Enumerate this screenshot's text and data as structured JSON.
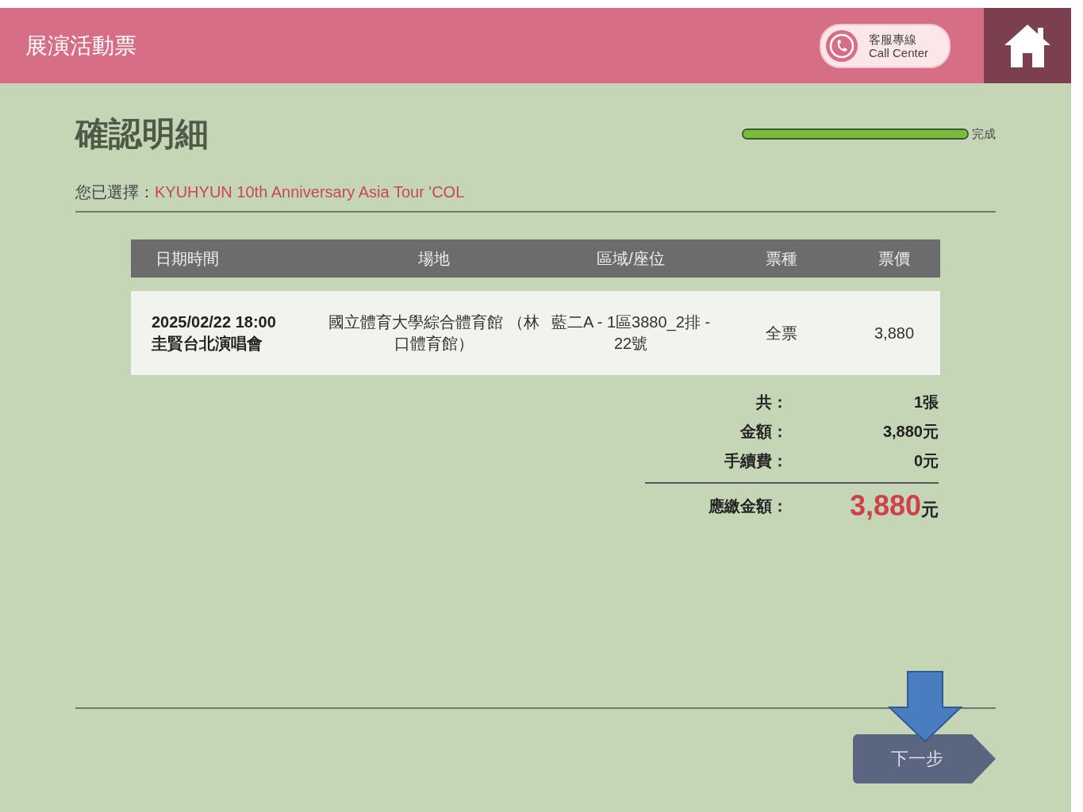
{
  "header": {
    "title": "展演活動票",
    "call_center": {
      "line1": "客服專線",
      "line2": "Call Center"
    }
  },
  "page_title": "確認明細",
  "progress": {
    "level": 1,
    "label": "完成"
  },
  "selection": {
    "label": "您已選擇：",
    "event": "KYUHYUN 10th Anniversary Asia Tour 'COL"
  },
  "table": {
    "columns": [
      "日期時間",
      "場地",
      "區域/座位",
      "票種",
      "票價"
    ],
    "rows": [
      {
        "date": "2025/02/22 18:00",
        "event": "圭賢台北演唱會",
        "venue": "國立體育大學綜合體育館 （林口體育館）",
        "seat": "藍二A - 1區3880_2排 - 22號",
        "ticket_type": "全票",
        "price": "3,880"
      }
    ]
  },
  "summary": [
    {
      "label": "共：",
      "value": "1張"
    },
    {
      "label": "金額：",
      "value": "3,880元"
    },
    {
      "label": "手續費：",
      "value": "0元"
    }
  ],
  "total": {
    "label": "應繳金額：",
    "amount": "3,880",
    "unit": "元"
  },
  "next_button": "下一步"
}
